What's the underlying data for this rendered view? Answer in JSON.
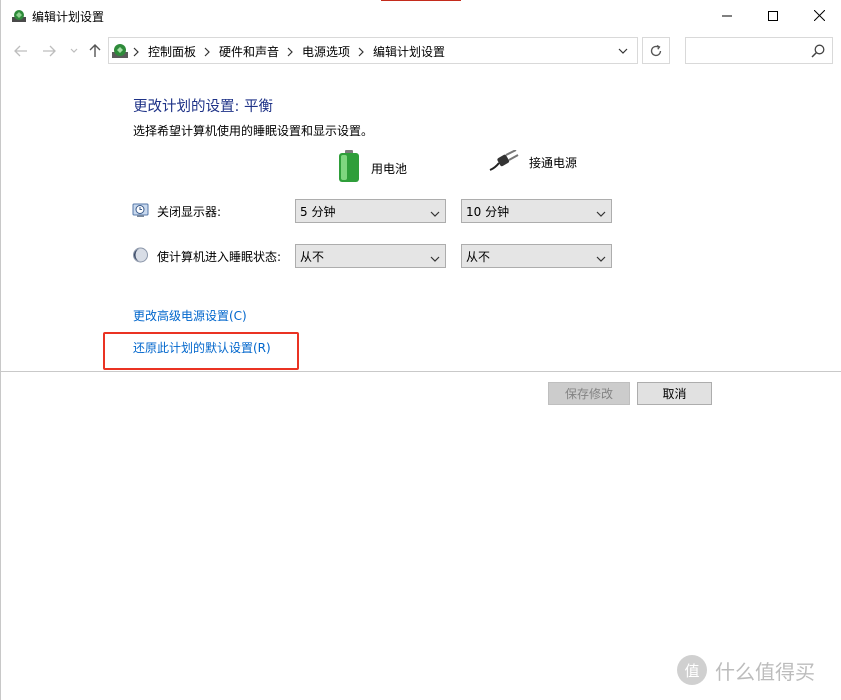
{
  "window": {
    "title": "编辑计划设置",
    "controls": {
      "minimize": "minimize",
      "maximize": "maximize",
      "close": "close"
    }
  },
  "address": {
    "breadcrumbs": [
      "控制面板",
      "硬件和声音",
      "电源选项",
      "编辑计划设置"
    ],
    "search_placeholder": ""
  },
  "content": {
    "title": "更改计划的设置: 平衡",
    "subtitle": "选择希望计算机使用的睡眠设置和显示设置。",
    "columns": {
      "battery": "用电池",
      "plugged_in": "接通电源"
    },
    "rows": [
      {
        "label": "关闭显示器:",
        "battery_value": "5 分钟",
        "plugged_value": "10 分钟"
      },
      {
        "label": "使计算机进入睡眠状态:",
        "battery_value": "从不",
        "plugged_value": "从不"
      }
    ],
    "links": {
      "advanced": "更改高级电源设置(C)",
      "restore": "还原此计划的默认设置(R)"
    }
  },
  "buttons": {
    "save": "保存修改",
    "cancel": "取消"
  },
  "watermark": {
    "text": "什么值得买",
    "badge": "值"
  },
  "colors": {
    "title_blue": "#1e3287",
    "link_blue": "#0066cc",
    "highlight_red": "#ea3323",
    "battery_green": "#3cb043"
  }
}
